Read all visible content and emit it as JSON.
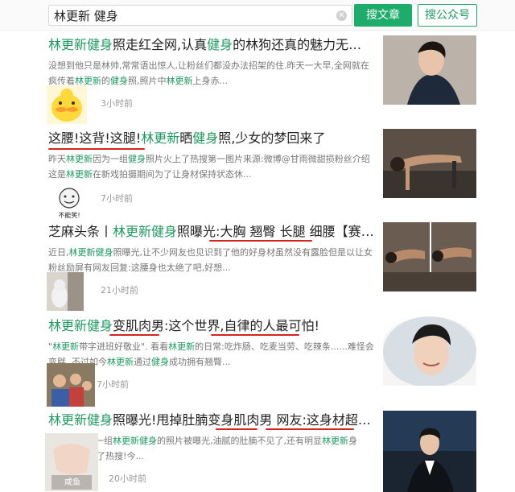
{
  "search": {
    "query": "林更新 健身",
    "clear_icon": "clear-icon",
    "btn_article": "搜文章",
    "btn_account": "搜公众号"
  },
  "results": [
    {
      "title_parts": [
        {
          "t": "林更新健身",
          "hl": true
        },
        {
          "t": "照走红全网,认真",
          "hl": false
        },
        {
          "t": "健身",
          "hl": true
        },
        {
          "t": "的林狗还真的魅力无法挡",
          "hl": false
        }
      ],
      "snippet_parts": [
        {
          "t": "没想到他只是林帅,常常语出惊人,让粉丝们都没办法招架的住.昨天一大早,全网就在疯传着",
          "hl": false
        },
        {
          "t": "林更新",
          "hl": true
        },
        {
          "t": "的",
          "hl": false
        },
        {
          "t": "健身",
          "hl": true
        },
        {
          "t": "照,照片中",
          "hl": false
        },
        {
          "t": "林更新",
          "hl": true
        },
        {
          "t": "上身赤...",
          "hl": false
        }
      ],
      "time": "3小时前",
      "avatar": "duck-avatar",
      "thumb": "man-portrait-thumb"
    },
    {
      "title_parts": [
        {
          "t": "这腰!这背!这腿!",
          "hl": false
        },
        {
          "t": "林更新",
          "hl": true
        },
        {
          "t": "晒",
          "hl": false
        },
        {
          "t": "健身",
          "hl": true
        },
        {
          "t": "照,少女的梦回来了",
          "hl": false
        }
      ],
      "snippet_parts": [
        {
          "t": "昨天",
          "hl": false
        },
        {
          "t": "林更新",
          "hl": true
        },
        {
          "t": "因为一组",
          "hl": false
        },
        {
          "t": "健身",
          "hl": true
        },
        {
          "t": "照片火上了热搜第一图片来源:微博@甘雨微甜损粉丝介绍这是",
          "hl": false
        },
        {
          "t": "林更新",
          "hl": true
        },
        {
          "t": "在新戏拍摄期间为了让身材保持状态休...",
          "hl": false
        }
      ],
      "time": "7小时前",
      "avatar": "meme-face-avatar",
      "avatar_caption": "不能笑!",
      "thumb": "pushup-thumb"
    },
    {
      "title_parts": [
        {
          "t": "芝麻头条丨",
          "hl": false
        },
        {
          "t": "林更新健身",
          "hl": true
        },
        {
          "t": "照曝光:大胸 翘臀 长腿 细腰【赛中...",
          "hl": false
        }
      ],
      "snippet_parts": [
        {
          "t": "近日,",
          "hl": false
        },
        {
          "t": "林更新",
          "hl": true
        },
        {
          "t": "健身",
          "hl": true
        },
        {
          "t": "照曝光,让不少网友也见识到了他的好身材虽然没有露脸但是以让女粉丝励屏有网友回复:这腰身也太绝了吧,好想...",
          "hl": false
        }
      ],
      "time": "21小时前",
      "avatar": "cat-avatar",
      "thumb": "workout-thumb"
    },
    {
      "title_parts": [
        {
          "t": "林更新健身",
          "hl": true
        },
        {
          "t": "变肌肉男:这个世界,自律的人最可怕!",
          "hl": false
        }
      ],
      "snippet_parts": [
        {
          "t": "\"",
          "hl": false
        },
        {
          "t": "林更新",
          "hl": true
        },
        {
          "t": "带字进班好敬业\". 看看",
          "hl": false
        },
        {
          "t": "林更新",
          "hl": true
        },
        {
          "t": "的日常:吃炸肠、吃麦当劳、吃辣条......难怪会变胖. 不过如今",
          "hl": false
        },
        {
          "t": "林更新",
          "hl": true
        },
        {
          "t": "通过",
          "hl": false
        },
        {
          "t": "健身",
          "hl": true
        },
        {
          "t": "成功拥有翘臀...",
          "hl": false
        }
      ],
      "time": "7小时前",
      "avatar": "group-photo-avatar",
      "thumb": "smiling-man-thumb"
    },
    {
      "title_parts": [
        {
          "t": "林更新健身",
          "hl": true
        },
        {
          "t": "照曝光!甩掉肚腩变身肌肉男 网友:这身材超级...",
          "hl": false
        }
      ],
      "snippet_parts": [
        {
          "t": "...今天早上,一组",
          "hl": false
        },
        {
          "t": "林更新健身",
          "hl": true
        },
        {
          "t": "的照片被曝光,油腻的肚腩不见了,还有明显",
          "hl": false
        },
        {
          "t": "林更新",
          "hl": true
        },
        {
          "t": "身材\"一下子上了热搜!今...",
          "hl": false
        }
      ],
      "time": "20小时前",
      "avatar": "hands-avatar",
      "avatar_caption": "咸鱼",
      "thumb": "suit-man-thumb"
    }
  ]
}
